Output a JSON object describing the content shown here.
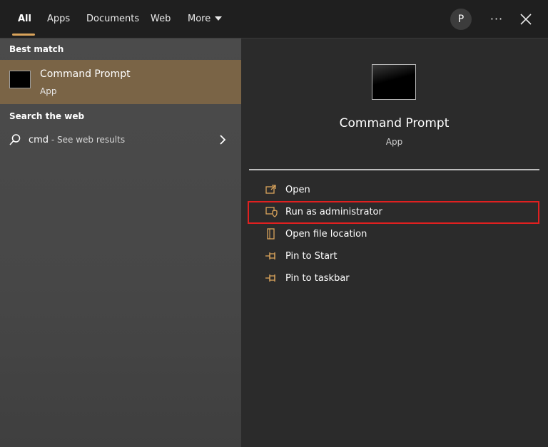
{
  "tabs": [
    {
      "label": "All",
      "active": true
    },
    {
      "label": "Apps"
    },
    {
      "label": "Documents"
    },
    {
      "label": "Web"
    },
    {
      "label": "More"
    }
  ],
  "header": {
    "avatar_initial": "P",
    "more_options": "···"
  },
  "best_match": {
    "section_title": "Best match",
    "title": "Command Prompt",
    "subtitle": "App"
  },
  "search_web": {
    "section_title": "Search the web",
    "query": "cmd",
    "suffix": " - See web results"
  },
  "detail": {
    "title": "Command Prompt",
    "subtitle": "App"
  },
  "actions": [
    {
      "label": "Open",
      "icon": "open-icon"
    },
    {
      "label": "Run as administrator",
      "icon": "shield-icon"
    },
    {
      "label": "Open file location",
      "icon": "file-location-icon"
    },
    {
      "label": "Pin to Start",
      "icon": "pin-icon"
    },
    {
      "label": "Pin to taskbar",
      "icon": "pin-icon"
    }
  ],
  "colors": {
    "accent": "#d9a35b",
    "selection": "#7a6446",
    "highlight_box": "#e02020"
  }
}
